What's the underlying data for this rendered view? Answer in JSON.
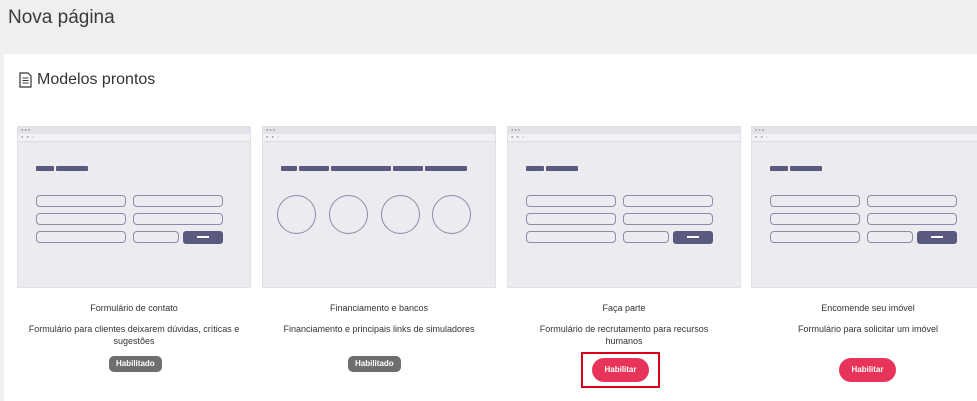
{
  "page": {
    "title": "Nova página"
  },
  "section": {
    "title": "Modelos prontos",
    "icon": "document-icon"
  },
  "cards": [
    {
      "title": "Formulário de contato",
      "description": "Formulário para clientes deixarem dúvidas, críticas e sugestões",
      "button": "Habilitado",
      "status": "enabled"
    },
    {
      "title": "Financiamento e bancos",
      "description": "Financiamento e principais links de simuladores",
      "button": "Habilitado",
      "status": "enabled"
    },
    {
      "title": "Faça parte",
      "description": "Formulário de recrutamento para recursos humanos",
      "button": "Habilitar",
      "status": "available"
    },
    {
      "title": "Encomende seu imóvel",
      "description": "Formulário para solicitar um imóvel",
      "button": "Habilitar",
      "status": "available"
    }
  ],
  "colors": {
    "enable_button": "#e8345a",
    "enabled_button": "#6e6e6e",
    "highlight_border": "#d8001c",
    "thumbnail_accent": "#5a5a80"
  }
}
